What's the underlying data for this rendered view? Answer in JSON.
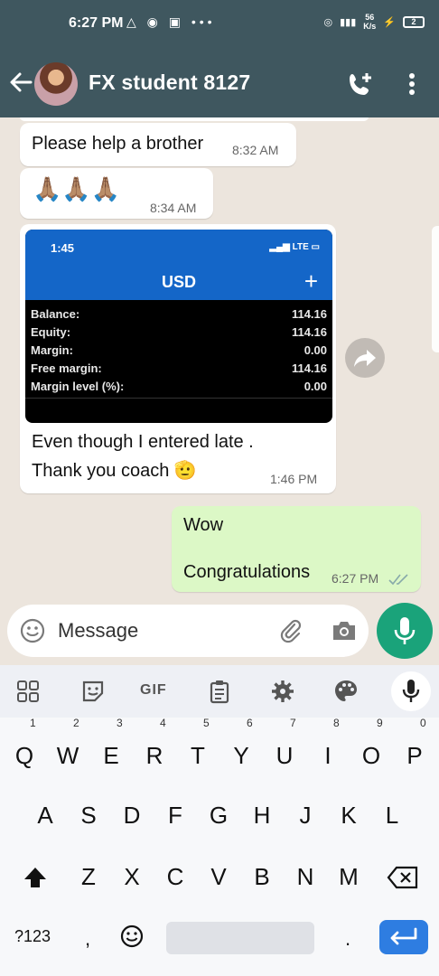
{
  "status_bar": {
    "time": "6:27 PM",
    "net_speed_value": "56",
    "net_speed_unit": "K/s",
    "battery": "2"
  },
  "header": {
    "title": "FX student 8127"
  },
  "messages": [
    {
      "direction": "in",
      "text": "Please help a brother",
      "time": "8:32 AM"
    },
    {
      "direction": "in",
      "text": "🙏🏽🙏🏽🙏🏽",
      "time": "8:34 AM"
    },
    {
      "direction": "in",
      "image": {
        "time": "1:45",
        "status": "LTE",
        "title": "USD",
        "rows": [
          {
            "label": "Balance:",
            "value": "114.16"
          },
          {
            "label": "Equity:",
            "value": "114.16"
          },
          {
            "label": "Margin:",
            "value": "0.00"
          },
          {
            "label": "Free margin:",
            "value": "114.16"
          },
          {
            "label": "Margin level (%):",
            "value": "0.00"
          }
        ]
      },
      "line1": "Even though I entered late .",
      "line2": "Thank you coach 🫡",
      "time": "1:46 PM"
    },
    {
      "direction": "out",
      "line1": "Wow",
      "line2": "Congratulations",
      "time": "6:27 PM"
    }
  ],
  "input": {
    "placeholder": "Message"
  },
  "keyboard": {
    "toolbar_gif": "GIF",
    "row1": [
      "Q",
      "W",
      "E",
      "R",
      "T",
      "Y",
      "U",
      "I",
      "O",
      "P"
    ],
    "row1_numbers": [
      "1",
      "2",
      "3",
      "4",
      "5",
      "6",
      "7",
      "8",
      "9",
      "0"
    ],
    "row2": [
      "A",
      "S",
      "D",
      "F",
      "G",
      "H",
      "J",
      "K",
      "L"
    ],
    "row3": [
      "Z",
      "X",
      "C",
      "V",
      "B",
      "N",
      "M"
    ],
    "symbols_key": "?123",
    "comma_key": ",",
    "period_key": "."
  },
  "colors": {
    "header": "#3f575f",
    "outgoing_bubble": "#dcf8c6",
    "fab": "#1aa37a",
    "enter_key": "#2e7de1",
    "screenshot_header": "#1466c8"
  },
  "icons": [
    "back-arrow-icon",
    "add-call-icon",
    "more-vert-icon",
    "forward-icon",
    "emoji-icon",
    "attach-icon",
    "camera-icon",
    "mic-icon",
    "apps-grid-icon",
    "sticker-icon",
    "clipboard-icon",
    "settings-icon",
    "palette-icon",
    "shift-icon",
    "backspace-icon",
    "enter-icon"
  ]
}
